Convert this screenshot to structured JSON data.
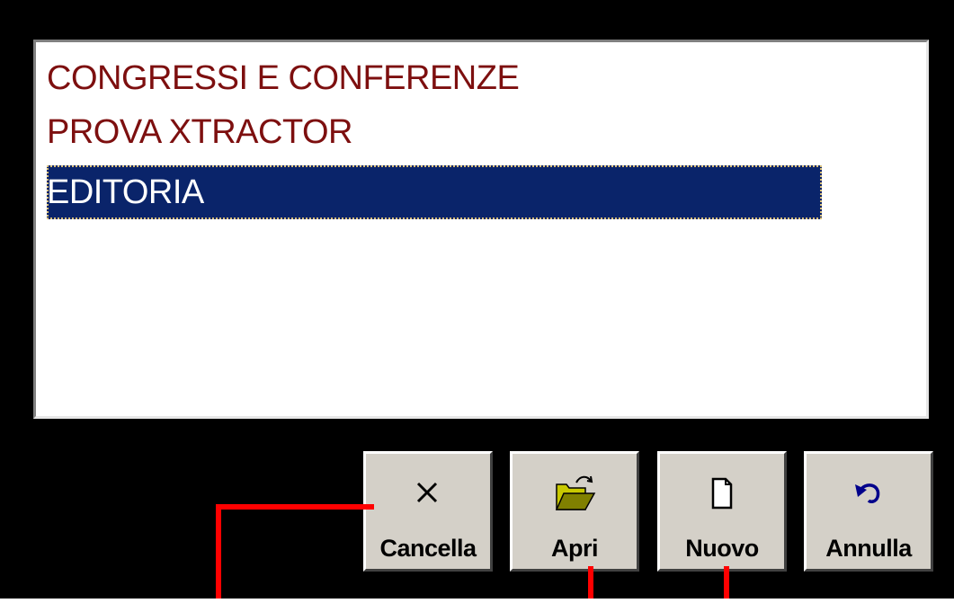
{
  "list": {
    "items": [
      {
        "label": "CONGRESSI E CONFERENZE",
        "selected": false
      },
      {
        "label": "PROVA XTRACTOR",
        "selected": false
      },
      {
        "label": "EDITORIA",
        "selected": true
      }
    ]
  },
  "buttons": {
    "cancella": {
      "label": "Cancella",
      "icon": "close-icon"
    },
    "apri": {
      "label": "Apri",
      "icon": "open-folder-icon"
    },
    "nuovo": {
      "label": "Nuovo",
      "icon": "new-document-icon"
    },
    "annulla": {
      "label": "Annulla",
      "icon": "undo-icon"
    }
  },
  "colors": {
    "list_text": "#7d0f0f",
    "selection_bg": "#0a246a",
    "annotation": "#ff0000"
  }
}
